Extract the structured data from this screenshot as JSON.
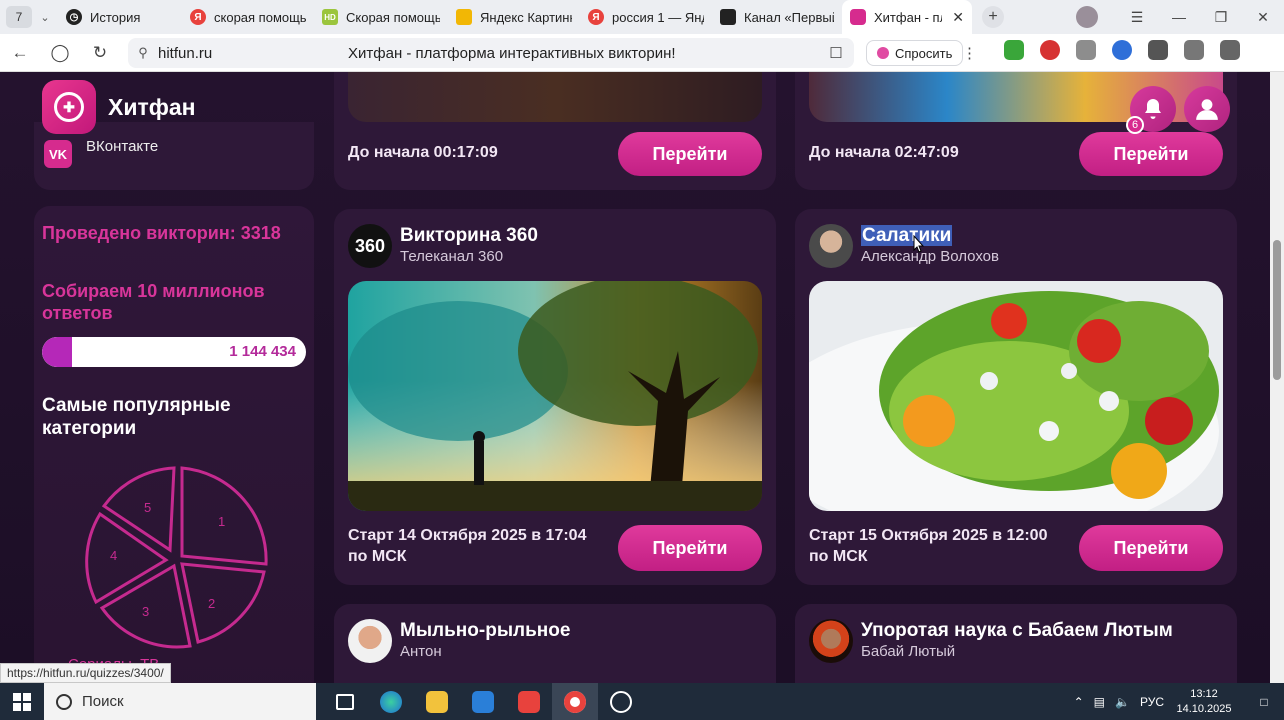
{
  "browser": {
    "tab_counter": "7",
    "tabs": [
      {
        "title": "История",
        "icon": "clock-icon",
        "color": "#222222"
      },
      {
        "title": "скорая помощь",
        "icon": "yandex-icon",
        "color": "#e8423d"
      },
      {
        "title": "Скорая помощь",
        "icon": "hd-icon",
        "color": "#9bc53d"
      },
      {
        "title": "Яндекс Картинк",
        "icon": "images-icon",
        "color": "#f2b705"
      },
      {
        "title": "россия 1 — Янд",
        "icon": "yandex-icon",
        "color": "#e8423d"
      },
      {
        "title": "Канал «Первый",
        "icon": "channel-icon",
        "color": "#222222"
      },
      {
        "title": "Хитфан - пла",
        "icon": "hitfun-icon",
        "color": "#d62b8e"
      }
    ],
    "url_host": "hitfun.ru",
    "page_title": "Хитфан - платформа интерактивных викторин!",
    "ask_label": "Спросить",
    "status_url": "https://hitfun.ru/quizzes/3400/"
  },
  "site": {
    "brand": "Хитфан",
    "notifications_count": "6",
    "vk_label": "ВКонтакте",
    "accent": "#d8359a"
  },
  "sidebar": {
    "quizzes_held": "Проведено викторин: 3318",
    "goal": "Собираем 10 миллионов ответов",
    "progress_value": "1 144 434",
    "progress_fraction": 0.114,
    "popular_title": "Самые популярные категории",
    "pie_labels": [
      "1",
      "2",
      "3",
      "4",
      "5"
    ],
    "category_partial": "Сериалы, ТВ"
  },
  "prev_cards": [
    {
      "timer": "До начала 00:17:09",
      "button": "Перейти"
    },
    {
      "timer": "До начала 02:47:09",
      "button": "Перейти"
    }
  ],
  "cards": [
    {
      "title": "Викторина 360",
      "subtitle": "Телеканал 360",
      "date": "Старт 14 Октября 2025 в 17:04 по МСК",
      "button": "Перейти",
      "avatar_text": "360"
    },
    {
      "title": "Салатики",
      "subtitle": "Александр Волохов",
      "date": "Старт 15 Октября 2025 в 12:00 по МСК",
      "button": "Перейти",
      "avatar_text": ""
    },
    {
      "title": "Мыльно-рыльное",
      "subtitle": "Антон"
    },
    {
      "title": "Упоротая наука с Бабаем Лютым",
      "subtitle": "Бабай Лютый"
    }
  ],
  "taskbar": {
    "search_label": "Поиск",
    "lang": "РУС",
    "time": "13:12",
    "date": "14.10.2025"
  }
}
